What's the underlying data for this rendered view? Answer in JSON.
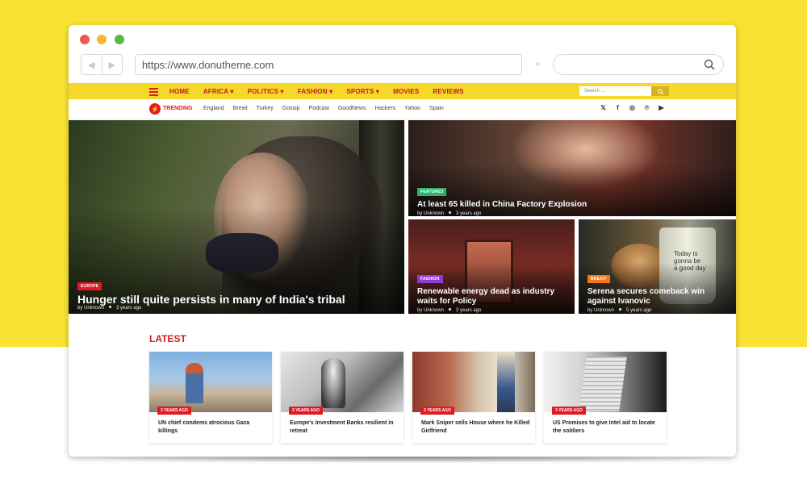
{
  "browser": {
    "url": "https://www.donutheme.com",
    "back_glyph": "◀",
    "forward_glyph": "▶"
  },
  "site": {
    "nav": [
      "HOME",
      "AFRICA ▾",
      "POLITICS ▾",
      "FASHION ▾",
      "SPORTS ▾",
      "MOVIES",
      "REVIEWS"
    ],
    "search_placeholder": "Search ...",
    "trending_label": "TRENDING",
    "trending_tags": [
      "England",
      "Brexit",
      "Turkey",
      "Gossip",
      "Podcast",
      "GoodNews",
      "Hackers",
      "Yahoo",
      "Spain"
    ],
    "social_icons": [
      "twitter-icon",
      "facebook-icon",
      "instagram-icon",
      "pinterest-icon",
      "youtube-icon"
    ],
    "social_glyphs": [
      "𝕏",
      "f",
      "◎",
      "℗",
      "▶"
    ]
  },
  "hero": {
    "main": {
      "badge": "EUROPE",
      "badge_color": "#e11a22",
      "title": "Hunger still quite persists in many of India's tribal",
      "author": "by Unknown",
      "time": "3 years ago"
    },
    "top": {
      "badge": "FEATURED",
      "badge_color": "#2ab36b",
      "title": "At least 65 killed in China Factory Explosion",
      "author": "by Unknown",
      "time": "3 years ago"
    },
    "bottom_left": {
      "badge": "FASHION",
      "badge_color": "#8e3bd6",
      "title": "Renewable energy dead as industry waits for Policy",
      "author": "by Unknown",
      "time": "3 years ago"
    },
    "bottom_right": {
      "badge": "BREXIT",
      "badge_color": "#f07a1a",
      "title": "Serena secures comeback win against Ivanovic",
      "author": "by Unknown",
      "time": "5 years ago",
      "cup_text": "Today is gonna be a good day"
    }
  },
  "latest": {
    "heading": "LATEST",
    "cards": [
      {
        "badge": "3 YEARS AGO",
        "title": "UN chief condems atrocious Gaza killings"
      },
      {
        "badge": "3 YEARS AGO",
        "title": "Europe's Investment Banks resilient in retreat"
      },
      {
        "badge": "3 YEARS AGO",
        "title": "Mark Sniper sells House where he Killed Girlfriend"
      },
      {
        "badge": "3 YEARS AGO",
        "title": "US Promises to give Intel aid to locate the soldiers"
      }
    ]
  },
  "colors": {
    "brand_yellow": "#f9e233",
    "nav_red": "#c4161c",
    "accent_red": "#e11a22"
  }
}
